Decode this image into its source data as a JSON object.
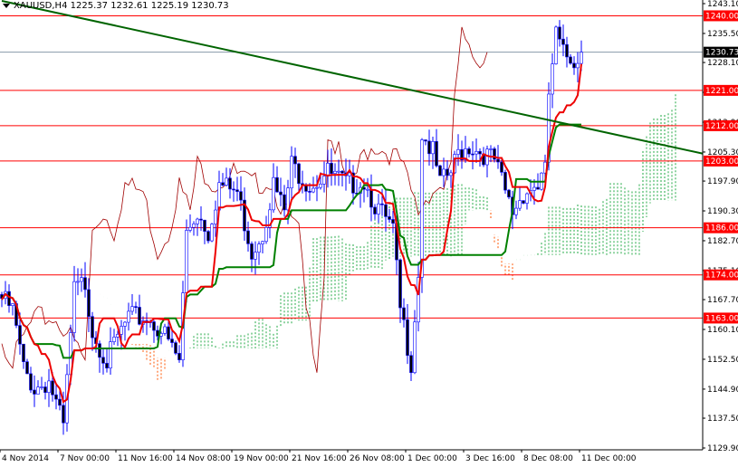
{
  "header": {
    "symbol": "XAUUSD,H4",
    "open": "1225.37",
    "high": "1232.61",
    "low": "1225.19",
    "close": "1230.73"
  },
  "colors": {
    "level": "#ff0000",
    "trend": "#006400",
    "tenkan": "#ee0000",
    "kijun": "#008000",
    "chikou": "#a00000",
    "bull_cloud": "#22aa44",
    "bear_cloud": "#ff5500",
    "candle": "#0000ff",
    "current": "#000000"
  },
  "chart_data": {
    "type": "candlestick",
    "title": "XAUUSD,H4",
    "ylim": [
      1129.9,
      1243.1
    ],
    "y_ticks": [
      "1243.10",
      "1235.50",
      "1228.10",
      "1220.50",
      "1212.90",
      "1205.30",
      "1197.90",
      "1190.30",
      "1182.70",
      "1175.10",
      "1167.70",
      "1160.10",
      "1152.50",
      "1144.90",
      "1137.50",
      "1129.90"
    ],
    "x_ticks": [
      "4 Nov 2014",
      "7 Nov 00:00",
      "11 Nov 16:00",
      "14 Nov 08:00",
      "19 Nov 00:00",
      "21 Nov 16:00",
      "26 Nov 08:00",
      "1 Dec 00:00",
      "3 Dec 16:00",
      "8 Dec 08:00",
      "11 Dec 00:00"
    ],
    "x_tick_bars": [
      0,
      16,
      32,
      48,
      64,
      80,
      96,
      112,
      128,
      144,
      160
    ],
    "levels": [
      "1240.00",
      "1221.00",
      "1212.00",
      "1203.00",
      "1186.00",
      "1174.00",
      "1163.00"
    ],
    "current_price": "1230.73",
    "trendline": {
      "from": [
        0,
        1243.8
      ],
      "to": [
        194,
        1204.8
      ]
    },
    "close_anchors": [
      [
        0,
        1168
      ],
      [
        3,
        1165
      ],
      [
        6,
        1150
      ],
      [
        9,
        1145
      ],
      [
        13,
        1147
      ],
      [
        17,
        1135
      ],
      [
        20,
        1170
      ],
      [
        23,
        1172
      ],
      [
        25,
        1160
      ],
      [
        29,
        1152
      ],
      [
        32,
        1158
      ],
      [
        35,
        1163
      ],
      [
        40,
        1163
      ],
      [
        44,
        1160
      ],
      [
        49,
        1152
      ],
      [
        51,
        1185
      ],
      [
        54,
        1190
      ],
      [
        57,
        1185
      ],
      [
        60,
        1197
      ],
      [
        65,
        1195
      ],
      [
        69,
        1180
      ],
      [
        72,
        1185
      ],
      [
        75,
        1197
      ],
      [
        78,
        1190
      ],
      [
        80,
        1202
      ],
      [
        85,
        1197
      ],
      [
        90,
        1200
      ],
      [
        95,
        1197
      ],
      [
        100,
        1198
      ],
      [
        103,
        1192
      ],
      [
        108,
        1185
      ],
      [
        110,
        1165
      ],
      [
        113,
        1152
      ],
      [
        115,
        1175
      ],
      [
        116,
        1210
      ],
      [
        119,
        1205
      ],
      [
        121,
        1197
      ],
      [
        124,
        1200
      ],
      [
        126,
        1205
      ],
      [
        129,
        1207
      ],
      [
        133,
        1205
      ],
      [
        136,
        1203
      ],
      [
        139,
        1195
      ],
      [
        141,
        1190
      ],
      [
        144,
        1195
      ],
      [
        148,
        1197
      ],
      [
        150,
        1200
      ],
      [
        151,
        1220
      ],
      [
        153,
        1235
      ],
      [
        155,
        1230
      ],
      [
        158,
        1229
      ],
      [
        160,
        1230.73
      ]
    ],
    "indicator": "Ichimoku Kinko Hyo (9,26,52)"
  }
}
